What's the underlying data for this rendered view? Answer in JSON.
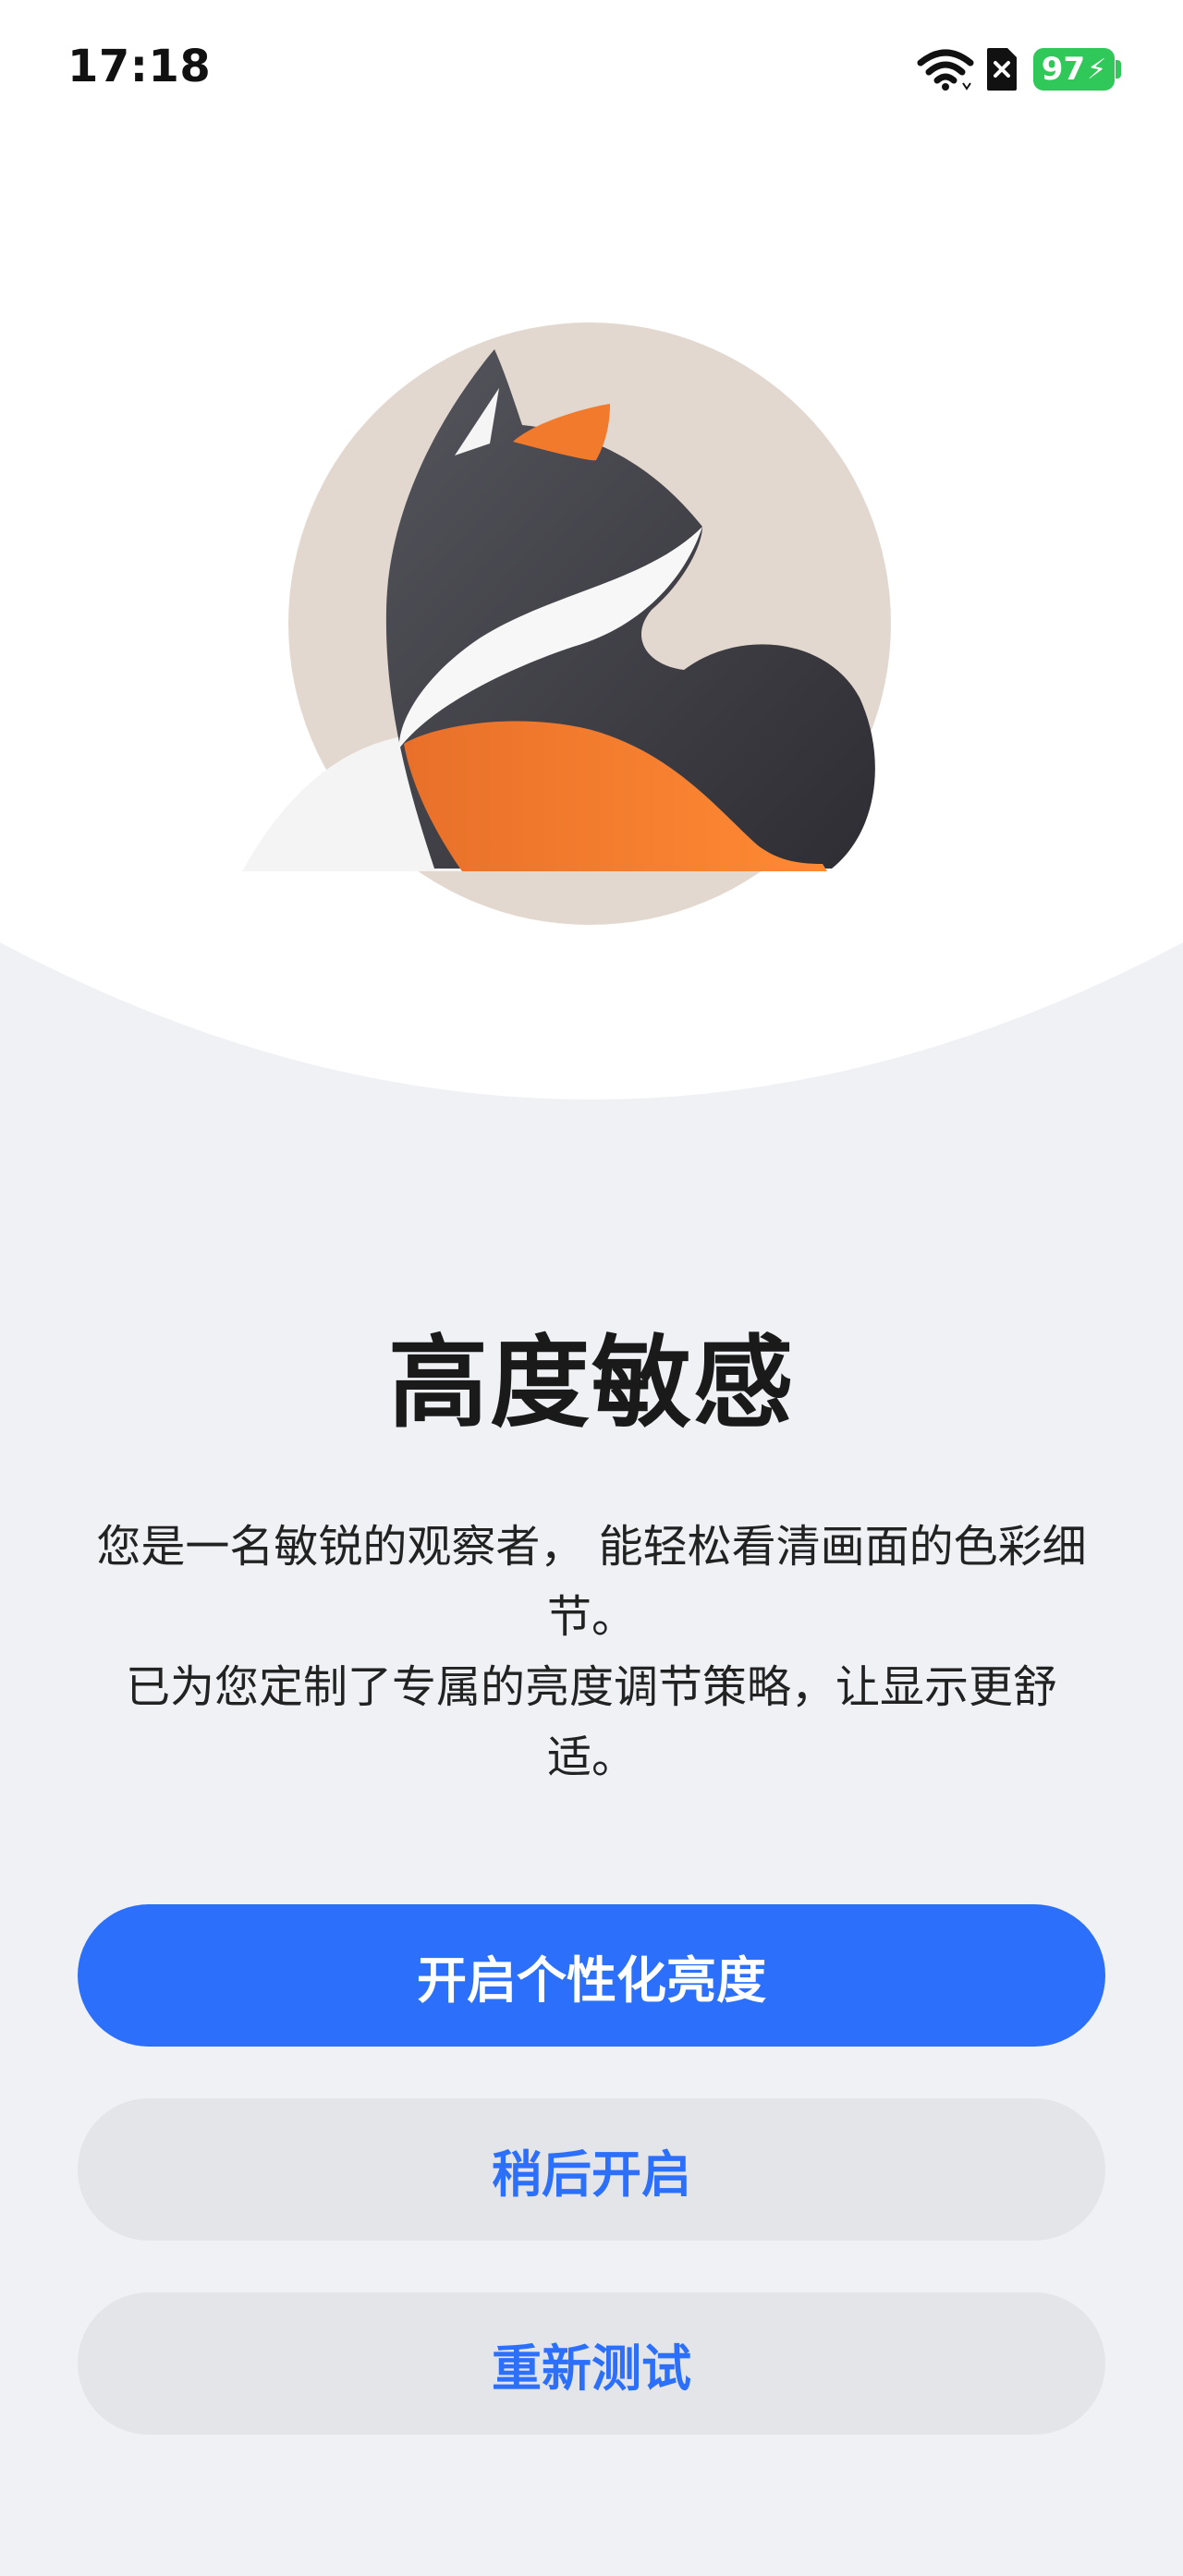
{
  "status_bar": {
    "time": "17:18",
    "battery_level": "97",
    "icons": [
      "wifi-icon",
      "sim-disabled-icon",
      "battery-charging-icon"
    ],
    "battery_color": "#31c85a"
  },
  "illustration": {
    "icon": "fox-illustration"
  },
  "main": {
    "title": "高度敏感",
    "description_lines": [
      "您是一名敏锐的观察者， 能轻松看清画面的色彩细节。",
      "已为您定制了专属的亮度调节策略，让显示更舒适。"
    ]
  },
  "buttons": {
    "enable": "开启个性化亮度",
    "later": "稍后开启",
    "retest": "重新测试"
  },
  "colors": {
    "accent": "#2b6ffb",
    "secondary_button_bg": "#e4e5e8",
    "page_bg": "#eff1f5"
  }
}
